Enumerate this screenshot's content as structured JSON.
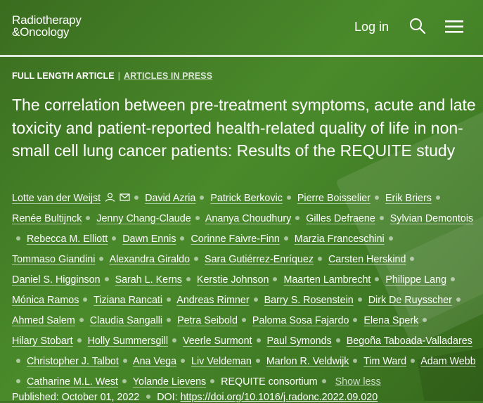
{
  "header": {
    "logo_line1": "Radiotherapy",
    "logo_line2": "&Oncology",
    "login_label": "Log in"
  },
  "article": {
    "type_label": "FULL LENGTH ARTICLE",
    "separator": "|",
    "status_label": "ARTICLES IN PRESS",
    "title": "The correlation between pre-treatment symptoms, acute and late toxicity and patient-reported health-related quality of life in non-small cell lung cancer patients: Results of the REQUITE study"
  },
  "authors": [
    "Lotte van der Weijst",
    "David Azria",
    "Patrick Berkovic",
    "Pierre Boisselier",
    "Erik Briers",
    "Renée Bultijnck",
    "Jenny Chang-Claude",
    "Ananya Choudhury",
    "Gilles Defraene",
    "Sylvian Demontois",
    "Rebecca M. Elliott",
    "Dawn Ennis",
    "Corinne Faivre-Finn",
    "Marzia Franceschini",
    "Tommaso Giandini",
    "Alexandra Giraldo",
    "Sara Gutiérrez-Enríquez",
    "Carsten Herskind",
    "Daniel S. Higginson",
    "Sarah L. Kerns",
    "Kerstie Johnson",
    "Maarten Lambrecht",
    "Philippe Lang",
    "Mónica Ramos",
    "Tiziana Rancati",
    "Andreas Rimner",
    "Barry S. Rosenstein",
    "Dirk De Ruysscher",
    "Ahmed Salem",
    "Claudia Sangalli",
    "Petra Seibold",
    "Paloma Sosa Fajardo",
    "Elena Sperk",
    "Hilary Stobart",
    "Holly Summersgill",
    "Veerle Surmont",
    "Paul Symonds",
    "Begoña Taboada-Valladares",
    "Christopher J. Talbot",
    "Ana Vega",
    "Liv Veldeman",
    "Marlon R. Veldwijk",
    "Tim Ward",
    "Adam Webb",
    "Catharine M.L. West",
    "Yolande Lievens",
    "REQUITE consortium"
  ],
  "show_less_label": "Show less",
  "pub": {
    "published_label": "Published:",
    "published_date": "October 01, 2022",
    "doi_label": "DOI:",
    "doi_url": "https://doi.org/10.1016/j.radonc.2022.09.020"
  },
  "icons": {
    "author_person": "person-icon",
    "author_email": "email-icon",
    "search": "search-icon",
    "menu": "hamburger-menu-icon"
  },
  "colors": {
    "background": "#3f7424",
    "text": "#ffffff"
  }
}
